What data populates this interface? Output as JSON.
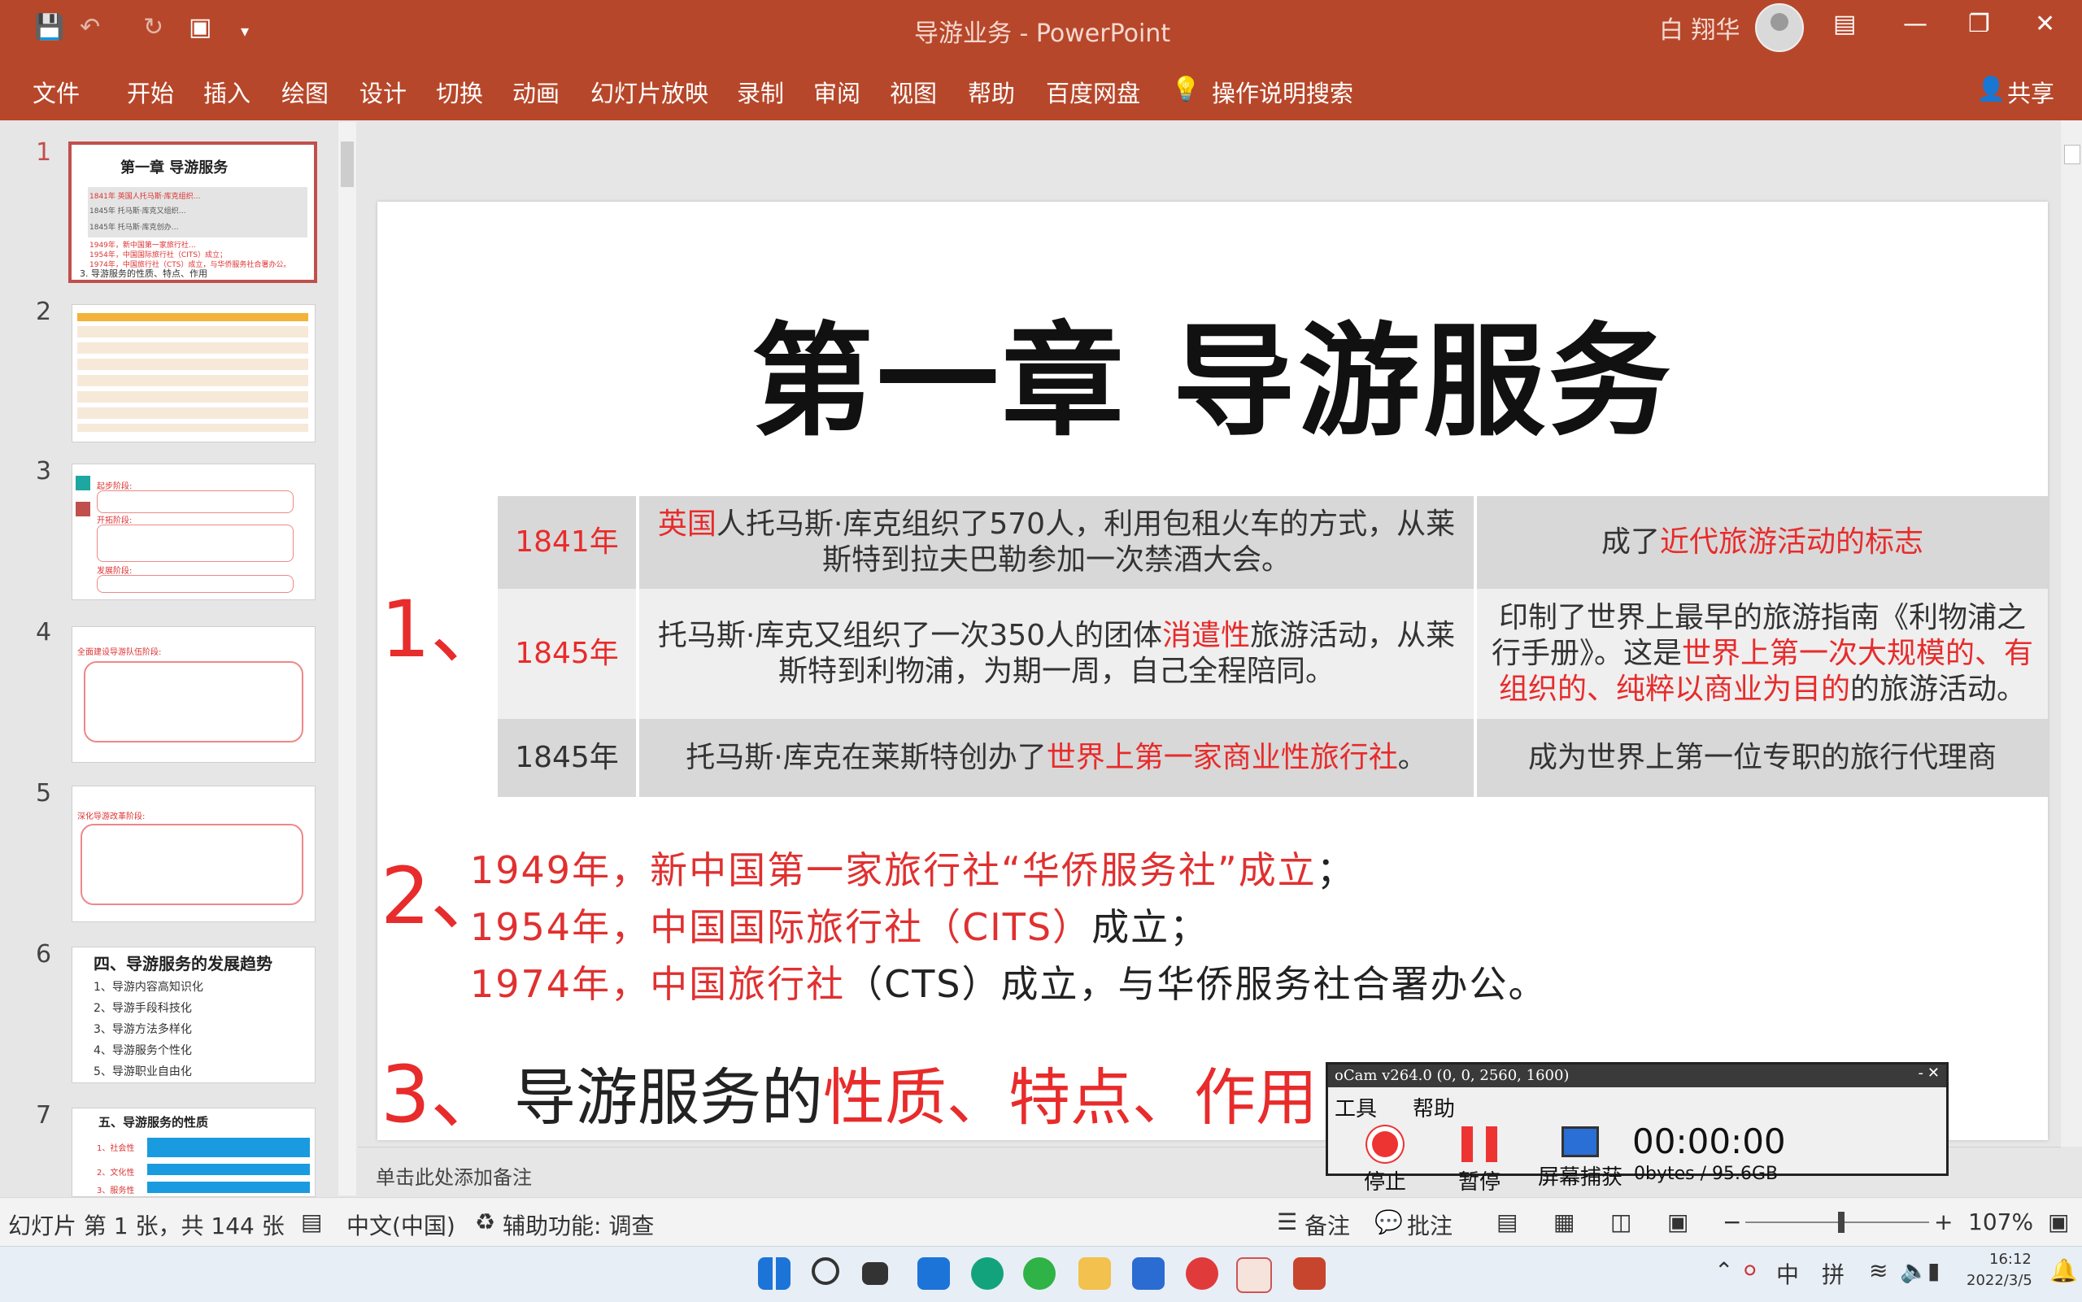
{
  "app": {
    "doc_title": "导游业务  -  PowerPoint",
    "user": "白 翔华"
  },
  "titlebar_icons": [
    "save-icon",
    "undo-icon",
    "redo-icon",
    "present-from-start-icon",
    "customize-icon"
  ],
  "menu": [
    "文件",
    "开始",
    "插入",
    "绘图",
    "设计",
    "切换",
    "动画",
    "幻灯片放映",
    "录制",
    "审阅",
    "视图",
    "帮助",
    "百度网盘"
  ],
  "tell_me": "操作说明搜索",
  "share": "共享",
  "thumbs": [
    {
      "num": "1",
      "title": "第一章 导游服务",
      "items": [
        "1841年 英国人托马斯·库克组织…",
        "1845年 托马斯·库克又组织…",
        "1845年 托马斯·库克创办…",
        "1949年，新中国第一家旅行社…",
        "1954年，中国国际旅行社（CITS）成立；",
        "1974年，中国旅行社（CTS）成立，与华侨服务社合署办公。",
        "3. 导游服务的性质、特点、作用"
      ]
    },
    {
      "num": "2"
    },
    {
      "num": "3",
      "labels": [
        "起步阶段:",
        "开拓阶段:",
        "发展阶段:"
      ]
    },
    {
      "num": "4",
      "labels": [
        "全面建设导游队伍阶段:"
      ]
    },
    {
      "num": "5",
      "labels": [
        "深化导游改革阶段:"
      ]
    },
    {
      "num": "6",
      "title": "四、导游服务的发展趋势",
      "items": [
        "1、导游内容高知识化",
        "2、导游手段科技化",
        "3、导游方法多样化",
        "4、导游服务个性化",
        "5、导游职业自由化"
      ]
    },
    {
      "num": "7",
      "title": "五、导游服务的性质",
      "items": [
        "1、社会性",
        "2、文化性",
        "3、服务性"
      ]
    }
  ],
  "slide": {
    "title": "第一章 导游服务",
    "sec1_num": "1、",
    "rows": [
      {
        "year": "1841年",
        "c1_pre": "",
        "c1_red": "英国",
        "c1_post": "人托马斯·库克组织了570人，利用包租火车的方式，从莱斯特到拉夫巴勒参加一次禁酒大会。",
        "c2_pre": "成了",
        "c2_red": "近代旅游活动的标志",
        "c2_post": ""
      },
      {
        "year": "1845年",
        "c1_pre": "托马斯·库克又组织了一次350人的团体",
        "c1_red": "消遣性",
        "c1_post": "旅游活动，从莱斯特到利物浦，为期一周，自己全程陪同。",
        "c2_pre": "印制了世界上最早的旅游指南《利物浦之行手册》。这是",
        "c2_red": "世界上第一次大规模的、有组织的、纯粹以商业为目的",
        "c2_post": "的旅游活动。"
      },
      {
        "year": "1845年",
        "c1_pre": "托马斯·库克在莱斯特创办了",
        "c1_red": "世界上第一家商业性旅行社",
        "c1_post": "。",
        "c2_pre": "成为世界上第一位专职的旅行代理商",
        "c2_red": "",
        "c2_post": ""
      }
    ],
    "sec2_num": "2、",
    "sec2": [
      {
        "red": "1949年，新中国第一家旅行社“华侨服务社”成立",
        "blk": "；"
      },
      {
        "red": "1954年，中国国际旅行社（CITS）",
        "blk": "成立；"
      },
      {
        "red": "1974年，中国旅行社",
        "blk": "（CTS）成立，与华侨服务社合署办公。"
      }
    ],
    "sec3_num": "3、",
    "sec3_pre": "导游服务的",
    "sec3_red": "性质、特点、作用"
  },
  "notes_placeholder": "单击此处添加备注",
  "status": {
    "slide_info": "幻灯片 第 1 张，共 144 张",
    "language": "中文(中国)",
    "accessibility": "辅助功能: 调查",
    "notes": "备注",
    "comments": "批注",
    "zoom": "107%"
  },
  "recorder": {
    "title": "oCam v264.0 (0, 0, 2560, 1600)",
    "menu": [
      "工具",
      "帮助"
    ],
    "buttons": [
      "停止",
      "暂停",
      "屏幕捕获"
    ],
    "timer": "00:00:00",
    "size": "0bytes / 95.6GB"
  },
  "tray": {
    "ime1": "中",
    "ime2": "拼",
    "time": "16:12",
    "date": "2022/3/5"
  },
  "colors": {
    "brand": "#b7472a",
    "accent_red": "#e82b2b"
  }
}
